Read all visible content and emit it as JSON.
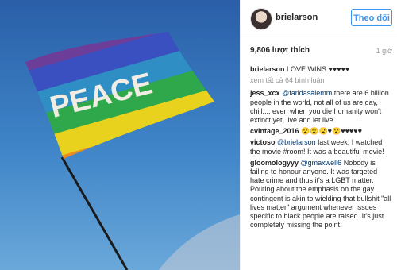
{
  "photo": {
    "flag_text": "PEACE",
    "flag_colors": [
      "#6d3d9a",
      "#3a4fc0",
      "#2f8ec4",
      "#2ea84a",
      "#e8d21d",
      "#f08a1e",
      "#e2271f"
    ],
    "sky_color": "#2f6db0"
  },
  "post": {
    "username": "brielarson",
    "follow_label": "Theo dõi",
    "likes": "9,806 lượt thích",
    "time": "1 giờ",
    "caption": {
      "user": "brielarson",
      "text": "LOVE WINS ♥♥♥♥♥"
    },
    "view_all": "xem tất cả 64 bình luận",
    "comments": [
      {
        "user": "jess_xcx",
        "mention": "@faridasalemm",
        "text": " there are 6 billion people in the world, not all of us are gay, chill.... even when you die humanity won't extinct yet, live and let live"
      },
      {
        "user": "cvintage_2016",
        "mention": "",
        "text": "😮😮😮♥😮♥♥♥♥♥"
      },
      {
        "user": "victoso",
        "mention": "@brielarson",
        "text": " last week, I watched the movie #room! It was a beautiful movie!"
      },
      {
        "user": "gloomologyyy",
        "mention": "@gmaxwell6",
        "text": " Nobody is failing to honour anyone. It was targeted hate crime and thus it's a LGBT matter. Pouting about the emphasis on the gay contingent is akin to wielding that bullshit \"all lives matter\" argument whenever issues specific to black people are raised. It's just completely missing the point."
      }
    ]
  }
}
